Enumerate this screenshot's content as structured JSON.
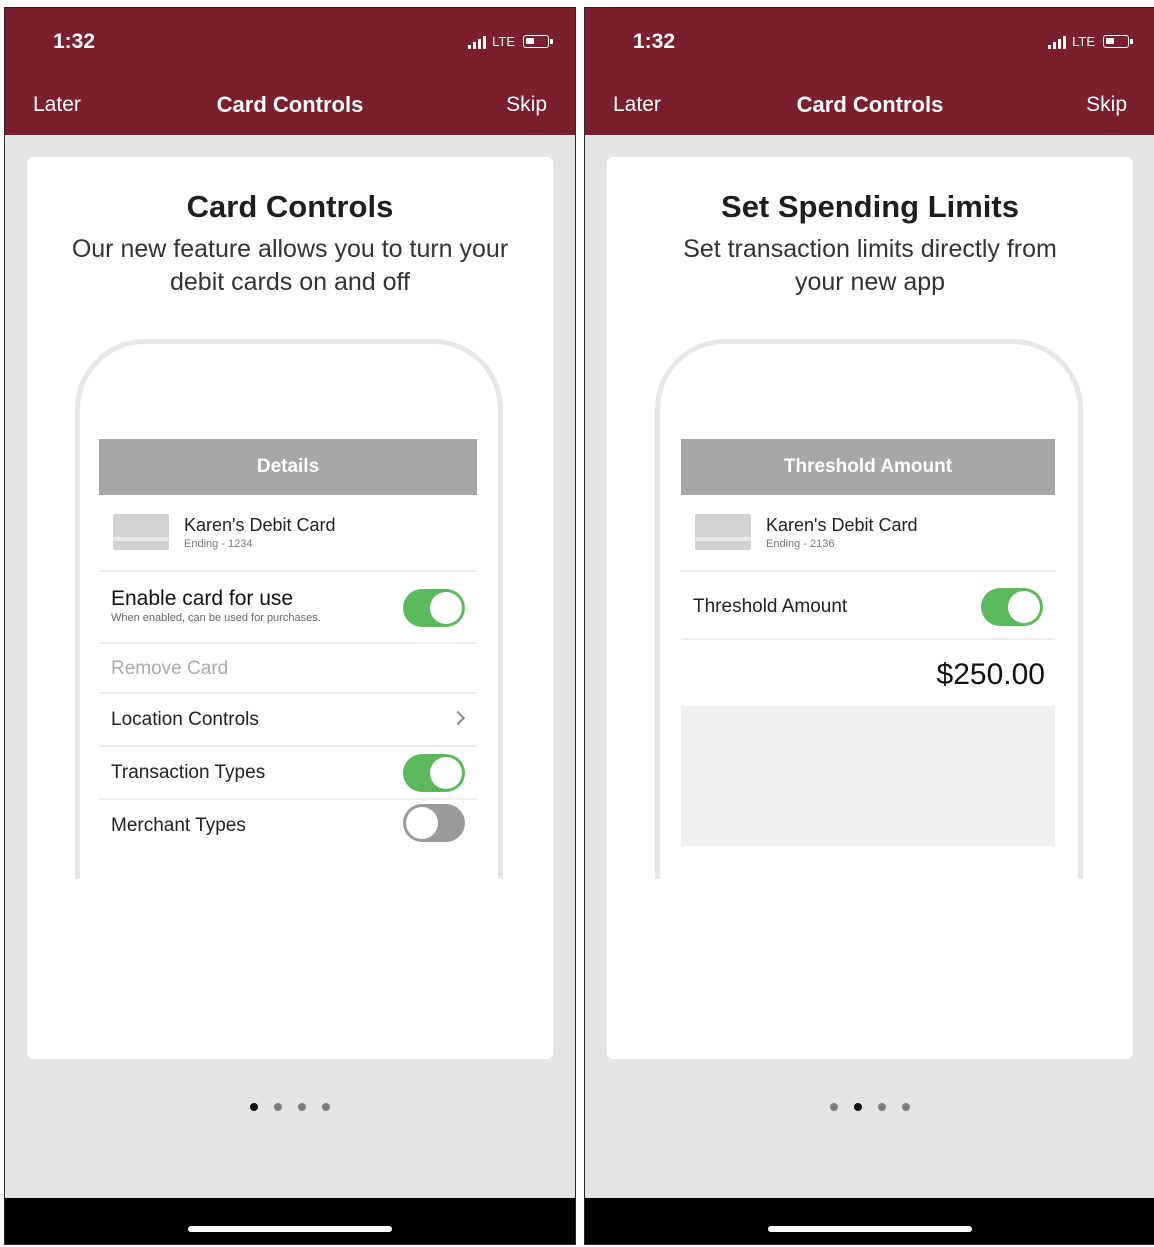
{
  "screens": [
    {
      "status": {
        "time": "1:32",
        "network": "LTE"
      },
      "nav": {
        "left": "Later",
        "title": "Card Controls",
        "right": "Skip"
      },
      "card": {
        "title": "Card Controls",
        "subtitle": "Our new feature allows you to turn your debit cards on and off",
        "mini": {
          "header": "Details",
          "card_name": "Karen's Debit Card",
          "card_ending": "Ending - 1234",
          "enable_label": "Enable card for use",
          "enable_hint": "When enabled, can be used for purchases.",
          "enable_on": true,
          "remove_label": "Remove Card",
          "location_label": "Location Controls",
          "transaction_label": "Transaction Types",
          "transaction_on": true,
          "merchant_label": "Merchant Types",
          "merchant_on": false
        }
      },
      "pager": {
        "total": 4,
        "active_index": 0
      }
    },
    {
      "status": {
        "time": "1:32",
        "network": "LTE"
      },
      "nav": {
        "left": "Later",
        "title": "Card Controls",
        "right": "Skip"
      },
      "card": {
        "title": "Set Spending Limits",
        "subtitle": "Set transaction limits directly from your new app",
        "mini": {
          "header": "Threshold Amount",
          "card_name": "Karen's Debit Card",
          "card_ending": "Ending - 2136",
          "threshold_label": "Threshold Amount",
          "threshold_on": true,
          "amount": "$250.00"
        }
      },
      "pager": {
        "total": 4,
        "active_index": 1
      }
    }
  ],
  "colors": {
    "header_bg": "#7a1f2b",
    "toggle_on": "#5cb85c",
    "toggle_off": "#9a9a9a",
    "mini_header_bg": "#a7a7a7"
  }
}
